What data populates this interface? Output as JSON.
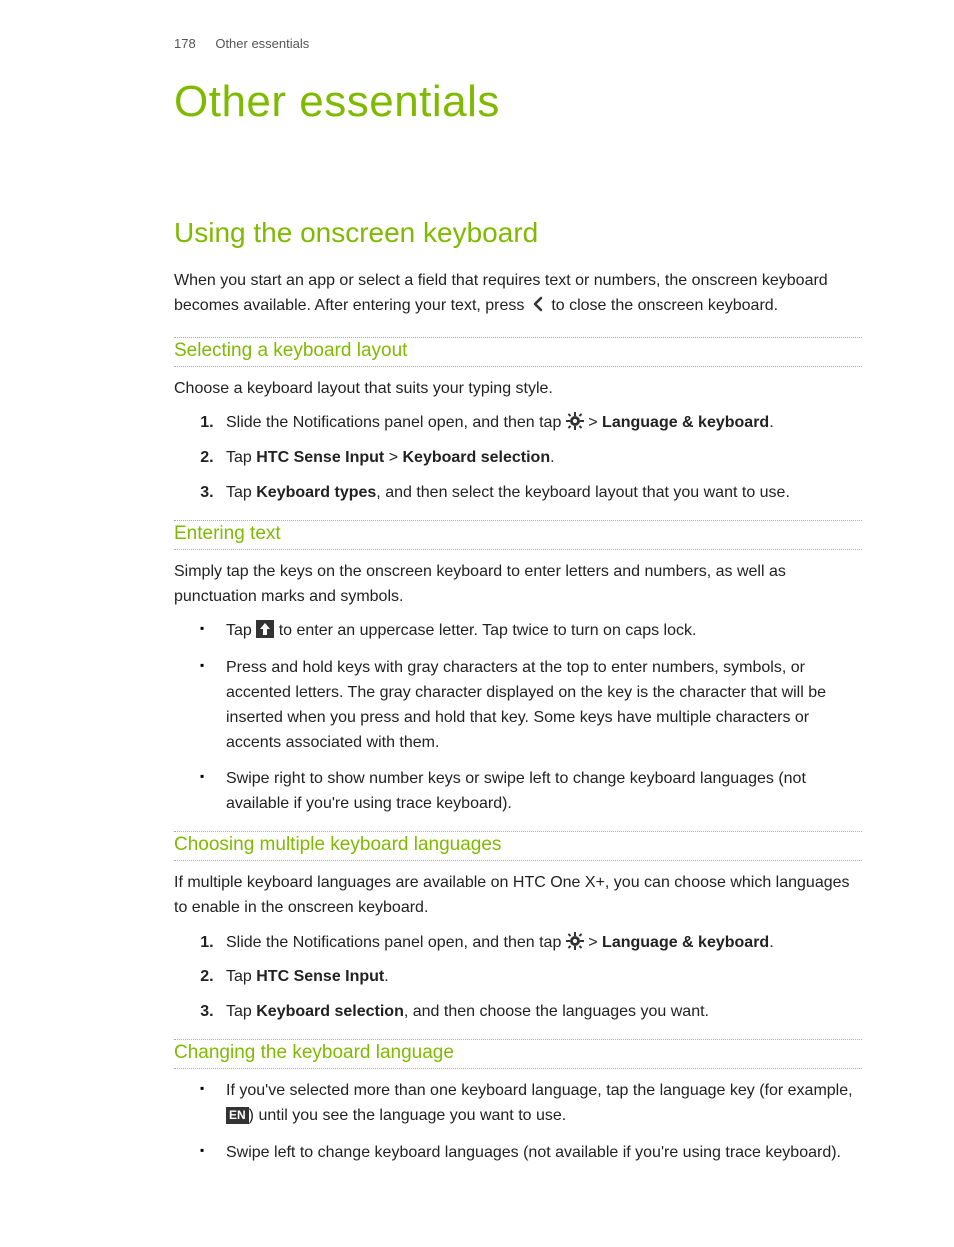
{
  "header": {
    "page_number": "178",
    "running_title": "Other essentials"
  },
  "chapter_title": "Other essentials",
  "section_title": "Using the onscreen keyboard",
  "intro": {
    "pre": "When you start an app or select a field that requires text or numbers, the onscreen keyboard becomes available. After entering your text, press ",
    "post": " to close the onscreen keyboard."
  },
  "subsections": {
    "selecting": {
      "title": "Selecting a keyboard layout",
      "lead": "Choose a keyboard layout that suits your typing style.",
      "steps": {
        "s1_pre": "Slide the Notifications panel open, and then tap ",
        "s1_gt": " > ",
        "s1_bold": "Language & keyboard",
        "s1_end": ".",
        "s2_pre": "Tap ",
        "s2_b1": "HTC Sense Input",
        "s2_mid": " > ",
        "s2_b2": "Keyboard selection",
        "s2_end": ".",
        "s3_pre": "Tap ",
        "s3_b": "Keyboard types",
        "s3_post": ", and then select the keyboard layout that you want to use."
      }
    },
    "entering": {
      "title": "Entering text",
      "lead": "Simply tap the keys on the onscreen keyboard to enter letters and numbers, as well as punctuation marks and symbols.",
      "bullets": {
        "b1_pre": "Tap ",
        "b1_post": " to enter an uppercase letter. Tap twice to turn on caps lock.",
        "b2": "Press and hold keys with gray characters at the top to enter numbers, symbols, or accented letters. The gray character displayed on the key is the character that will be inserted when you press and hold that key. Some keys have multiple characters or accents associated with them.",
        "b3": "Swipe right to show number keys or swipe left to change keyboard languages (not available if you're using trace keyboard)."
      }
    },
    "multi": {
      "title": "Choosing multiple keyboard languages",
      "lead": "If multiple keyboard languages are available on HTC One X+, you can choose which languages to enable in the onscreen keyboard.",
      "steps": {
        "s1_pre": "Slide the Notifications panel open, and then tap ",
        "s1_gt": " > ",
        "s1_bold": "Language & keyboard",
        "s1_end": ".",
        "s2_pre": "Tap ",
        "s2_b": "HTC Sense Input",
        "s2_end": ".",
        "s3_pre": "Tap ",
        "s3_b": "Keyboard selection",
        "s3_post": ", and then choose the languages you want."
      }
    },
    "changing": {
      "title": "Changing the keyboard language",
      "bullets": {
        "b1_pre": "If you've selected more than one keyboard language, tap the language key (for example, ",
        "b1_en": "EN",
        "b1_post": ") until you see the language you want to use.",
        "b2": "Swipe left to change keyboard languages (not available if you're using trace keyboard)."
      }
    }
  }
}
